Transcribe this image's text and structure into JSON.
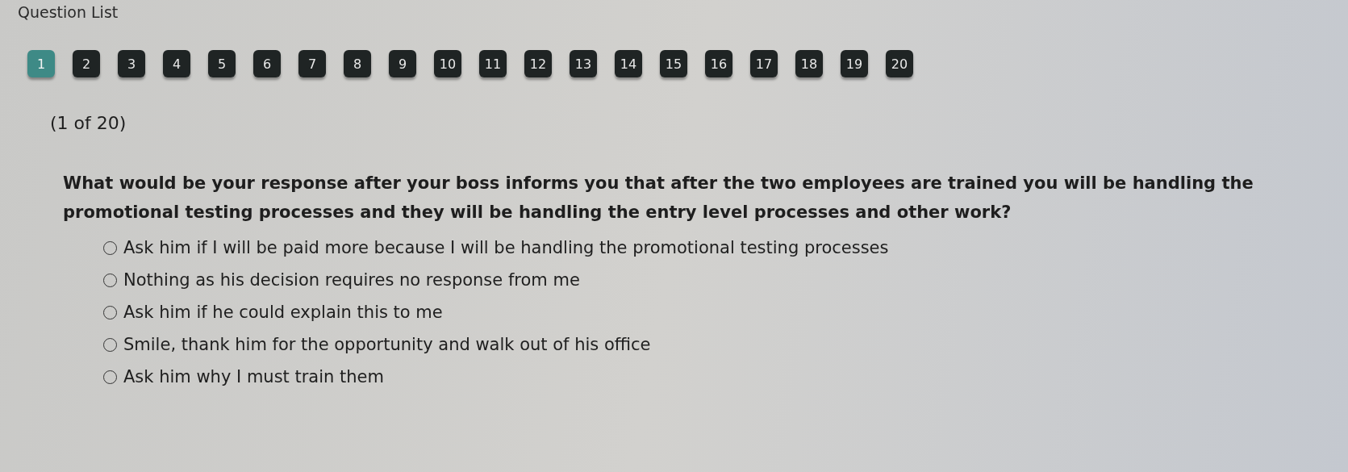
{
  "header": {
    "title": "Question List"
  },
  "question_nav": [
    {
      "label": "1",
      "selected": true
    },
    {
      "label": "2",
      "selected": false
    },
    {
      "label": "3",
      "selected": false
    },
    {
      "label": "4",
      "selected": false
    },
    {
      "label": "5",
      "selected": false
    },
    {
      "label": "6",
      "selected": false
    },
    {
      "label": "7",
      "selected": false
    },
    {
      "label": "8",
      "selected": false
    },
    {
      "label": "9",
      "selected": false
    },
    {
      "label": "10",
      "selected": false
    },
    {
      "label": "11",
      "selected": false
    },
    {
      "label": "12",
      "selected": false
    },
    {
      "label": "13",
      "selected": false
    },
    {
      "label": "14",
      "selected": false
    },
    {
      "label": "15",
      "selected": false
    },
    {
      "label": "16",
      "selected": false
    },
    {
      "label": "17",
      "selected": false
    },
    {
      "label": "18",
      "selected": false
    },
    {
      "label": "19",
      "selected": false
    },
    {
      "label": "20",
      "selected": false
    }
  ],
  "progress": "(1 of 20)",
  "question": "What would be your response after your boss informs you that after the two employees are trained you will be handling the promotional testing processes and they will be handling the entry level processes and other work?",
  "options": [
    {
      "label": "Ask him if I will be paid more because I will be handling the promotional testing processes",
      "selected": false
    },
    {
      "label": "Nothing as his decision requires no response from me",
      "selected": false
    },
    {
      "label": "Ask him if he could explain this to me",
      "selected": false
    },
    {
      "label": "Smile, thank him for the opportunity and walk out of his office",
      "selected": false
    },
    {
      "label": "Ask him why I must train them",
      "selected": false
    }
  ]
}
